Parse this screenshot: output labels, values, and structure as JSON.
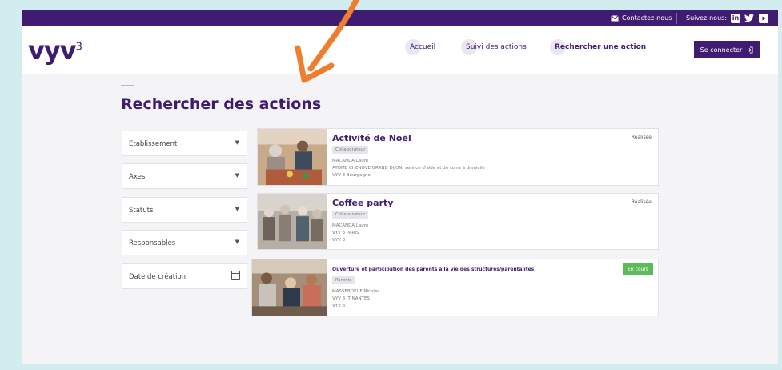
{
  "topbar": {
    "contact_label": "Contactez-nous",
    "follow_label": "Suivez-nous:",
    "social": [
      "in",
      "✓",
      "▶"
    ]
  },
  "brand": {
    "logo": "vyv",
    "logo_sup": "3"
  },
  "nav": [
    "Accueil",
    "Suivi des actions",
    "Rechercher une action"
  ],
  "login": {
    "label": "Se connecter",
    "icon": "login-icon"
  },
  "page": {
    "title": "Rechercher des actions"
  },
  "filters": [
    {
      "label": "Etablissement",
      "icon": "chevron-down-icon"
    },
    {
      "label": "Axes",
      "icon": "chevron-down-icon"
    },
    {
      "label": "Statuts",
      "icon": "chevron-down-icon"
    },
    {
      "label": "Responsables",
      "icon": "chevron-down-icon"
    },
    {
      "label": "Date de création",
      "icon": "calendar-icon"
    }
  ],
  "actions": [
    {
      "title": "Activité de Noël",
      "tag": "Collaborateur",
      "lines": [
        "MACANDA Laure",
        "ATOME CHENOVE GRAND DIJON, service d'aide et de soins à domicile",
        "VYV 3 Bourgogne"
      ],
      "status": "Réalisée"
    },
    {
      "title": "Coffee party",
      "tag": "Collaborateur",
      "lines": [
        "MACANDA Laure",
        "VYV 3 PARIS",
        "VYV 3"
      ],
      "status": "Réalisée"
    },
    {
      "title": "Ouverture et participation des parents à la vie des structures/parentalités",
      "tag": "Parents",
      "lines": [
        "MASSEBOEUF Nicolas",
        "VYV 3 IT NANTES",
        "VYV 3"
      ],
      "status": "En cours"
    }
  ],
  "colors": {
    "brand": "#3f1b72",
    "status_in_progress": "#5db95a",
    "annotation_arrow": "#ee7d2d"
  }
}
